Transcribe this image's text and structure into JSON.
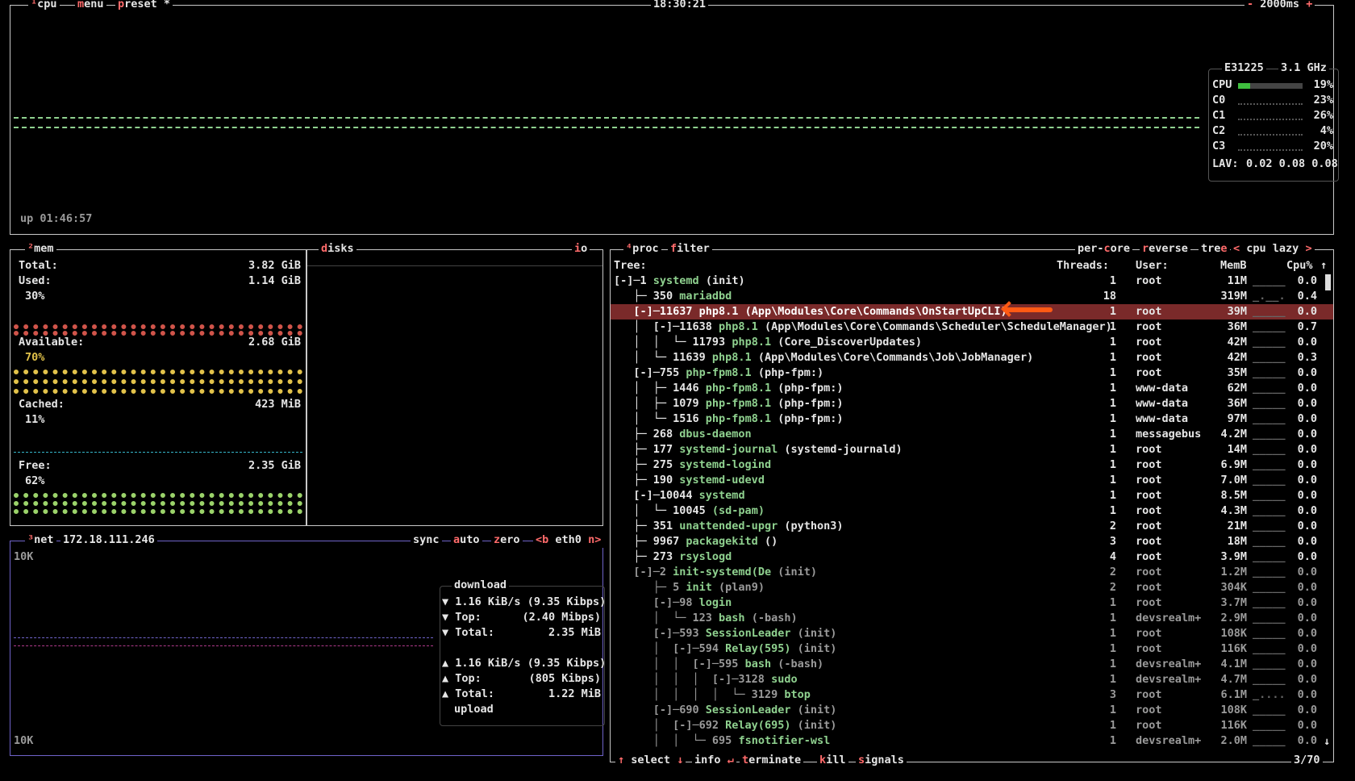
{
  "cpu_panel": {
    "tabs": [
      "cpu",
      "menu",
      "preset *"
    ],
    "tab_nums": [
      "¹",
      "",
      ""
    ],
    "clock": "18:30:21",
    "refresh_minus": "-",
    "refresh": "2000ms",
    "refresh_plus": "+",
    "uptime": "up 01:46:57",
    "model": "E31225",
    "freq": "3.1 GHz",
    "cores": [
      {
        "label": "CPU",
        "pct": "19%",
        "value": 0.19
      },
      {
        "label": "C0",
        "pct": "23%",
        "value": 0.23
      },
      {
        "label": "C1",
        "pct": "26%",
        "value": 0.26
      },
      {
        "label": "C2",
        "pct": "4%",
        "value": 0.04
      },
      {
        "label": "C3",
        "pct": "20%",
        "value": 0.2
      }
    ],
    "lav_label": "LAV:",
    "lav": "0.02 0.08 0.08"
  },
  "mem_panel": {
    "title_num": "²",
    "title": "mem",
    "total_label": "Total:",
    "total": "3.82 GiB",
    "used_label": "Used:",
    "used": "1.14 GiB",
    "used_pct": "30%",
    "available_label": "Available:",
    "available": "2.68 GiB",
    "available_pct": "70%",
    "cached_label": "Cached:",
    "cached": "423 MiB",
    "cached_pct": "11%",
    "free_label": "Free:",
    "free": "2.35 GiB",
    "free_pct": "62%"
  },
  "disks_panel": {
    "title_first": "d",
    "title_rest": "isks",
    "io_first": "i",
    "io_rest": "o"
  },
  "net_panel": {
    "title_num": "³",
    "title": "net",
    "ip": "172.18.111.246",
    "sync_rest": "sync",
    "auto_first": "a",
    "auto_rest": "uto",
    "zero_first": "z",
    "zero_rest": "ero",
    "iface_prev": "<b",
    "iface": "eth0",
    "iface_next": "n>",
    "scale_top": "10K",
    "scale_bottom": "10K",
    "download_label": "download",
    "download_rate": "1.16 KiB/s",
    "download_rate_bits": "(9.35 Kibps)",
    "download_top_label": "Top:",
    "download_top": "(2.40 Mibps)",
    "download_total_label": "Total:",
    "download_total": "2.35 MiB",
    "upload_rate": "1.16 KiB/s",
    "upload_rate_bits": "(9.35 Kibps)",
    "upload_top_label": "Top:",
    "upload_top": "(805 Kibps)",
    "upload_total_label": "Total:",
    "upload_total": "1.22 MiB",
    "upload_label": "upload"
  },
  "proc_panel": {
    "title_num": "⁴",
    "title": "proc",
    "filter_first": "f",
    "filter_rest": "ilter",
    "percore_a": "per-",
    "percore_b": "c",
    "percore_c": "ore",
    "reverse_first": "r",
    "reverse_rest": "everse",
    "tree_a": "tre",
    "tree_b": "e",
    "sort_prev": "<",
    "sort": "cpu lazy",
    "sort_next": ">",
    "headers": {
      "tree": "Tree:",
      "threads": "Threads:",
      "user": "User:",
      "mem": "MemB",
      "cpu": "Cpu%",
      "sort_arrow": "↑"
    },
    "rows": [
      {
        "prefix": "[-]─1 ",
        "name": "systemd",
        "args": " (init)",
        "threads": "1",
        "user": "root",
        "mem": "11M",
        "spark": "_____",
        "cpu": "0.0"
      },
      {
        "prefix": "   ├─ 350 ",
        "name": "mariadbd",
        "args": "",
        "threads": "18",
        "user": "",
        "mem": "319M",
        "spark": "_.__.",
        "cpu": "0.4"
      },
      {
        "prefix": "   [-]─11637 ",
        "name": "php8.1",
        "args": " (App\\Modules\\Core\\Commands\\OnStartUpCLI)",
        "threads": "1",
        "user": "root",
        "mem": "39M",
        "spark": "_____",
        "cpu": "0.0"
      },
      {
        "prefix": "   │  [-]─11638 ",
        "name": "php8.1",
        "args": " (App\\Modules\\Core\\Commands\\Scheduler\\ScheduleManager)",
        "threads": "1",
        "user": "root",
        "mem": "36M",
        "spark": "_____",
        "cpu": "0.7"
      },
      {
        "prefix": "   │  │  └─ 11793 ",
        "name": "php8.1",
        "args": " (Core_DiscoverUpdates)",
        "threads": "1",
        "user": "root",
        "mem": "42M",
        "spark": "_____",
        "cpu": "0.0"
      },
      {
        "prefix": "   │  └─ 11639 ",
        "name": "php8.1",
        "args": " (App\\Modules\\Core\\Commands\\Job\\JobManager)",
        "threads": "1",
        "user": "root",
        "mem": "42M",
        "spark": "_____",
        "cpu": "0.3"
      },
      {
        "prefix": "   [-]─755 ",
        "name": "php-fpm8.1",
        "args": " (php-fpm:)",
        "threads": "1",
        "user": "root",
        "mem": "35M",
        "spark": "_____",
        "cpu": "0.0"
      },
      {
        "prefix": "   │  ├─ 1446 ",
        "name": "php-fpm8.1",
        "args": " (php-fpm:)",
        "threads": "1",
        "user": "www-data",
        "mem": "62M",
        "spark": "_____",
        "cpu": "0.0"
      },
      {
        "prefix": "   │  ├─ 1079 ",
        "name": "php-fpm8.1",
        "args": " (php-fpm:)",
        "threads": "1",
        "user": "www-data",
        "mem": "36M",
        "spark": "_____",
        "cpu": "0.0"
      },
      {
        "prefix": "   │  └─ 1516 ",
        "name": "php-fpm8.1",
        "args": " (php-fpm:)",
        "threads": "1",
        "user": "www-data",
        "mem": "97M",
        "spark": "_____",
        "cpu": "0.0"
      },
      {
        "prefix": "   ├─ 268 ",
        "name": "dbus-daemon",
        "args": "",
        "threads": "1",
        "user": "messagebus",
        "mem": "4.2M",
        "spark": "_____",
        "cpu": "0.0"
      },
      {
        "prefix": "   ├─ 177 ",
        "name": "systemd-journal",
        "args": " (systemd-journald)",
        "threads": "1",
        "user": "root",
        "mem": "14M",
        "spark": "_____",
        "cpu": "0.0"
      },
      {
        "prefix": "   ├─ 275 ",
        "name": "systemd-logind",
        "args": "",
        "threads": "1",
        "user": "root",
        "mem": "6.9M",
        "spark": "_____",
        "cpu": "0.0"
      },
      {
        "prefix": "   ├─ 190 ",
        "name": "systemd-udevd",
        "args": "",
        "threads": "1",
        "user": "root",
        "mem": "7.0M",
        "spark": "_____",
        "cpu": "0.0"
      },
      {
        "prefix": "   [-]─10044 ",
        "name": "systemd",
        "args": "",
        "threads": "1",
        "user": "root",
        "mem": "8.5M",
        "spark": "_____",
        "cpu": "0.0"
      },
      {
        "prefix": "   │  └─ 10045 ",
        "name": "(sd-pam)",
        "args": "",
        "threads": "1",
        "user": "root",
        "mem": "4.3M",
        "spark": "_____",
        "cpu": "0.0"
      },
      {
        "prefix": "   ├─ 351 ",
        "name": "unattended-upgr",
        "args": " (python3)",
        "threads": "2",
        "user": "root",
        "mem": "21M",
        "spark": "_____",
        "cpu": "0.0"
      },
      {
        "prefix": "   ├─ 9967 ",
        "name": "packagekitd",
        "args": " ()",
        "threads": "3",
        "user": "root",
        "mem": "18M",
        "spark": "_____",
        "cpu": "0.0"
      },
      {
        "prefix": "   ├─ 273 ",
        "name": "rsyslogd",
        "args": "",
        "threads": "4",
        "user": "root",
        "mem": "3.9M",
        "spark": "_____",
        "cpu": "0.0"
      },
      {
        "prefix": "   [-]─2 ",
        "name": "init-systemd(De",
        "args": " (init)",
        "threads": "2",
        "user": "root",
        "mem": "1.2M",
        "spark": "_____",
        "cpu": "0.0"
      },
      {
        "prefix": "      ├─ 5 ",
        "name": "init",
        "args": " (plan9)",
        "threads": "2",
        "user": "root",
        "mem": "304K",
        "spark": "_____",
        "cpu": "0.0"
      },
      {
        "prefix": "      [-]─98 ",
        "name": "login",
        "args": "",
        "threads": "1",
        "user": "root",
        "mem": "3.7M",
        "spark": "_____",
        "cpu": "0.0"
      },
      {
        "prefix": "      │  └─ 123 ",
        "name": "bash",
        "args": " (-bash)",
        "threads": "1",
        "user": "devsrealm+",
        "mem": "2.9M",
        "spark": "_____",
        "cpu": "0.0"
      },
      {
        "prefix": "      [-]─593 ",
        "name": "SessionLeader",
        "args": " (init)",
        "threads": "1",
        "user": "root",
        "mem": "108K",
        "spark": "_____",
        "cpu": "0.0"
      },
      {
        "prefix": "      │  [-]─594 ",
        "name": "Relay(595)",
        "args": " (init)",
        "threads": "1",
        "user": "root",
        "mem": "116K",
        "spark": "_____",
        "cpu": "0.0"
      },
      {
        "prefix": "      │  │  [-]─595 ",
        "name": "bash",
        "args": " (-bash)",
        "threads": "1",
        "user": "devsrealm+",
        "mem": "4.1M",
        "spark": "_____",
        "cpu": "0.0"
      },
      {
        "prefix": "      │  │  │  [-]─3128 ",
        "name": "sudo",
        "args": "",
        "threads": "1",
        "user": "devsrealm+",
        "mem": "4.7M",
        "spark": "_____",
        "cpu": "0.0"
      },
      {
        "prefix": "      │  │  │  │  └─ 3129 ",
        "name": "btop",
        "args": "",
        "threads": "3",
        "user": "root",
        "mem": "6.1M",
        "spark": "_....",
        "cpu": "0.0"
      },
      {
        "prefix": "      [-]─690 ",
        "name": "SessionLeader",
        "args": " (init)",
        "threads": "1",
        "user": "root",
        "mem": "108K",
        "spark": "_____",
        "cpu": "0.0"
      },
      {
        "prefix": "      │  [-]─692 ",
        "name": "Relay(695)",
        "args": " (init)",
        "threads": "1",
        "user": "root",
        "mem": "116K",
        "spark": "_____",
        "cpu": "0.0"
      },
      {
        "prefix": "      │  │  └─ 695 ",
        "name": "fsnotifier-wsl",
        "args": "",
        "threads": "1",
        "user": "devsrealm+",
        "mem": "2.0M",
        "spark": "_____",
        "cpu": "0.0"
      }
    ],
    "selected_index": 2,
    "footer": {
      "select_up": "↑",
      "select": "select",
      "select_down": "↓",
      "info_key": "↵",
      "info": "info",
      "terminate_first": "t",
      "terminate_rest": "erminate",
      "kill_first": "k",
      "kill_rest": "ill",
      "signals_first": "s",
      "signals_rest": "ignals",
      "count": "3/70",
      "scroll_down": "↓"
    }
  },
  "colors": {
    "background": "#000000",
    "border": "#c8c8c8",
    "hotkey": "#ff6b6b",
    "process_name": "#8fd18f",
    "selected_row": "#7a2a2a",
    "annotation_arrow": "#ff5a14"
  }
}
